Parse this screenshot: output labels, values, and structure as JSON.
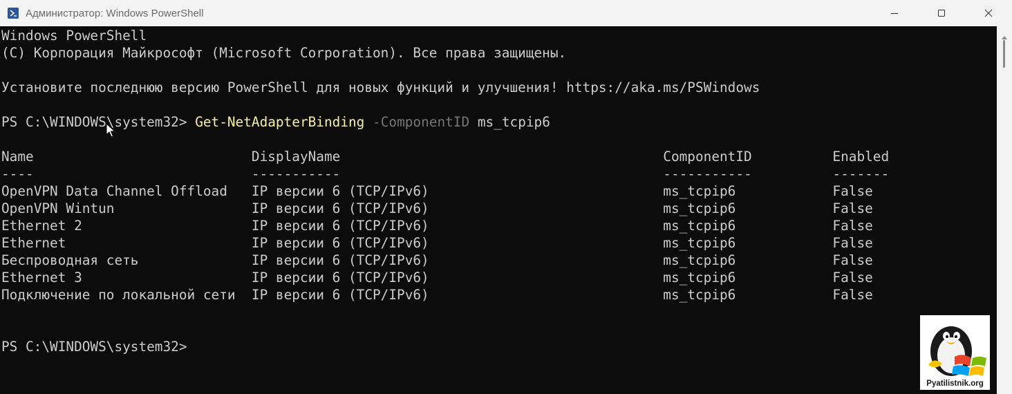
{
  "window": {
    "title": "Администратор: Windows PowerShell",
    "icon": "powershell-icon",
    "controls": [
      "minimize-icon",
      "maximize-icon",
      "close-icon"
    ]
  },
  "console": {
    "banner": [
      "Windows PowerShell",
      "(C) Корпорация Майкрософт (Microsoft Corporation). Все права защищены.",
      "Установите последнюю версию PowerShell для новых функций и улучшения! https://aka.ms/PSWindows"
    ],
    "prompt": "PS C:\\WINDOWS\\system32> ",
    "command": {
      "cmdlet": "Get-NetAdapterBinding",
      "parameter": "-ComponentID",
      "argument": "ms_tcpip6"
    },
    "table": {
      "headers": [
        "Name",
        "DisplayName",
        "ComponentID",
        "Enabled"
      ],
      "separators": [
        "----",
        "-----------",
        "-----------",
        "-------"
      ],
      "rows": [
        [
          "OpenVPN Data Channel Offload",
          "IP версии 6 (TCP/IPv6)",
          "ms_tcpip6",
          "False"
        ],
        [
          "OpenVPN Wintun",
          "IP версии 6 (TCP/IPv6)",
          "ms_tcpip6",
          "False"
        ],
        [
          "Ethernet 2",
          "IP версии 6 (TCP/IPv6)",
          "ms_tcpip6",
          "False"
        ],
        [
          "Ethernet",
          "IP версии 6 (TCP/IPv6)",
          "ms_tcpip6",
          "False"
        ],
        [
          "Беспроводная сеть",
          "IP версии 6 (TCP/IPv6)",
          "ms_tcpip6",
          "False"
        ],
        [
          "Ethernet 3",
          "IP версии 6 (TCP/IPv6)",
          "ms_tcpip6",
          "False"
        ],
        [
          "Подключение по локальной сети",
          "IP версии 6 (TCP/IPv6)",
          "ms_tcpip6",
          "False"
        ]
      ]
    },
    "final_prompt": "PS C:\\WINDOWS\\system32>"
  },
  "watermark": {
    "text": "Pyatilistnik.org",
    "icon": "penguin-logo-icon"
  },
  "colors": {
    "background": "#0c0c0c",
    "text": "#cccccc",
    "cmdlet": "#f9f1a5",
    "parameter": "#767676"
  }
}
